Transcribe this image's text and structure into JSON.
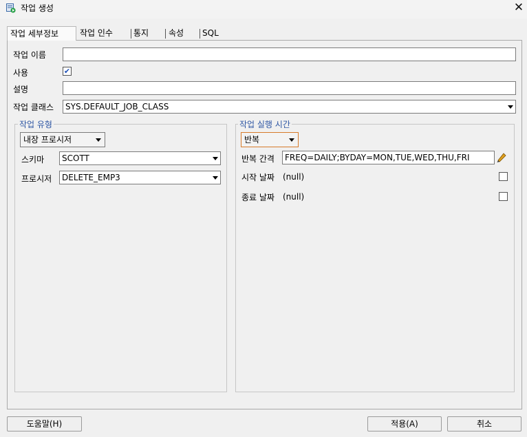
{
  "window": {
    "title": "작업 생성",
    "close_glyph": "✕"
  },
  "tabs": [
    {
      "label": "작업 세부정보"
    },
    {
      "label": "작업 인수"
    },
    {
      "label": "통지"
    },
    {
      "label": "속성"
    },
    {
      "label": "SQL"
    }
  ],
  "form": {
    "job_name_label": "작업 이름",
    "job_name_value": "",
    "enabled_label": "사용",
    "enabled_checked": true,
    "description_label": "설명",
    "description_value": "",
    "job_class_label": "작업 클래스",
    "job_class_value": "SYS.DEFAULT_JOB_CLASS"
  },
  "job_type": {
    "legend": "작업 유형",
    "type_value": "내장 프로시저",
    "schema_label": "스키마",
    "schema_value": "SCOTT",
    "procedure_label": "프로시저",
    "procedure_value": "DELETE_EMP3"
  },
  "schedule": {
    "legend": "작업 실행 시간",
    "mode_value": "반복",
    "interval_label": "반복 간격",
    "interval_value": "FREQ=DAILY;BYDAY=MON,TUE,WED,THU,FRI",
    "start_label": "시작 날짜",
    "start_value": "(null)",
    "end_label": "종료 날짜",
    "end_value": "(null)"
  },
  "footer": {
    "help_label": "도움말(H)",
    "apply_label": "적용(A)",
    "cancel_label": "취소"
  },
  "colors": {
    "accent": "#2f57a4",
    "focus": "#d77a2a",
    "pencil": "#e0a020"
  }
}
